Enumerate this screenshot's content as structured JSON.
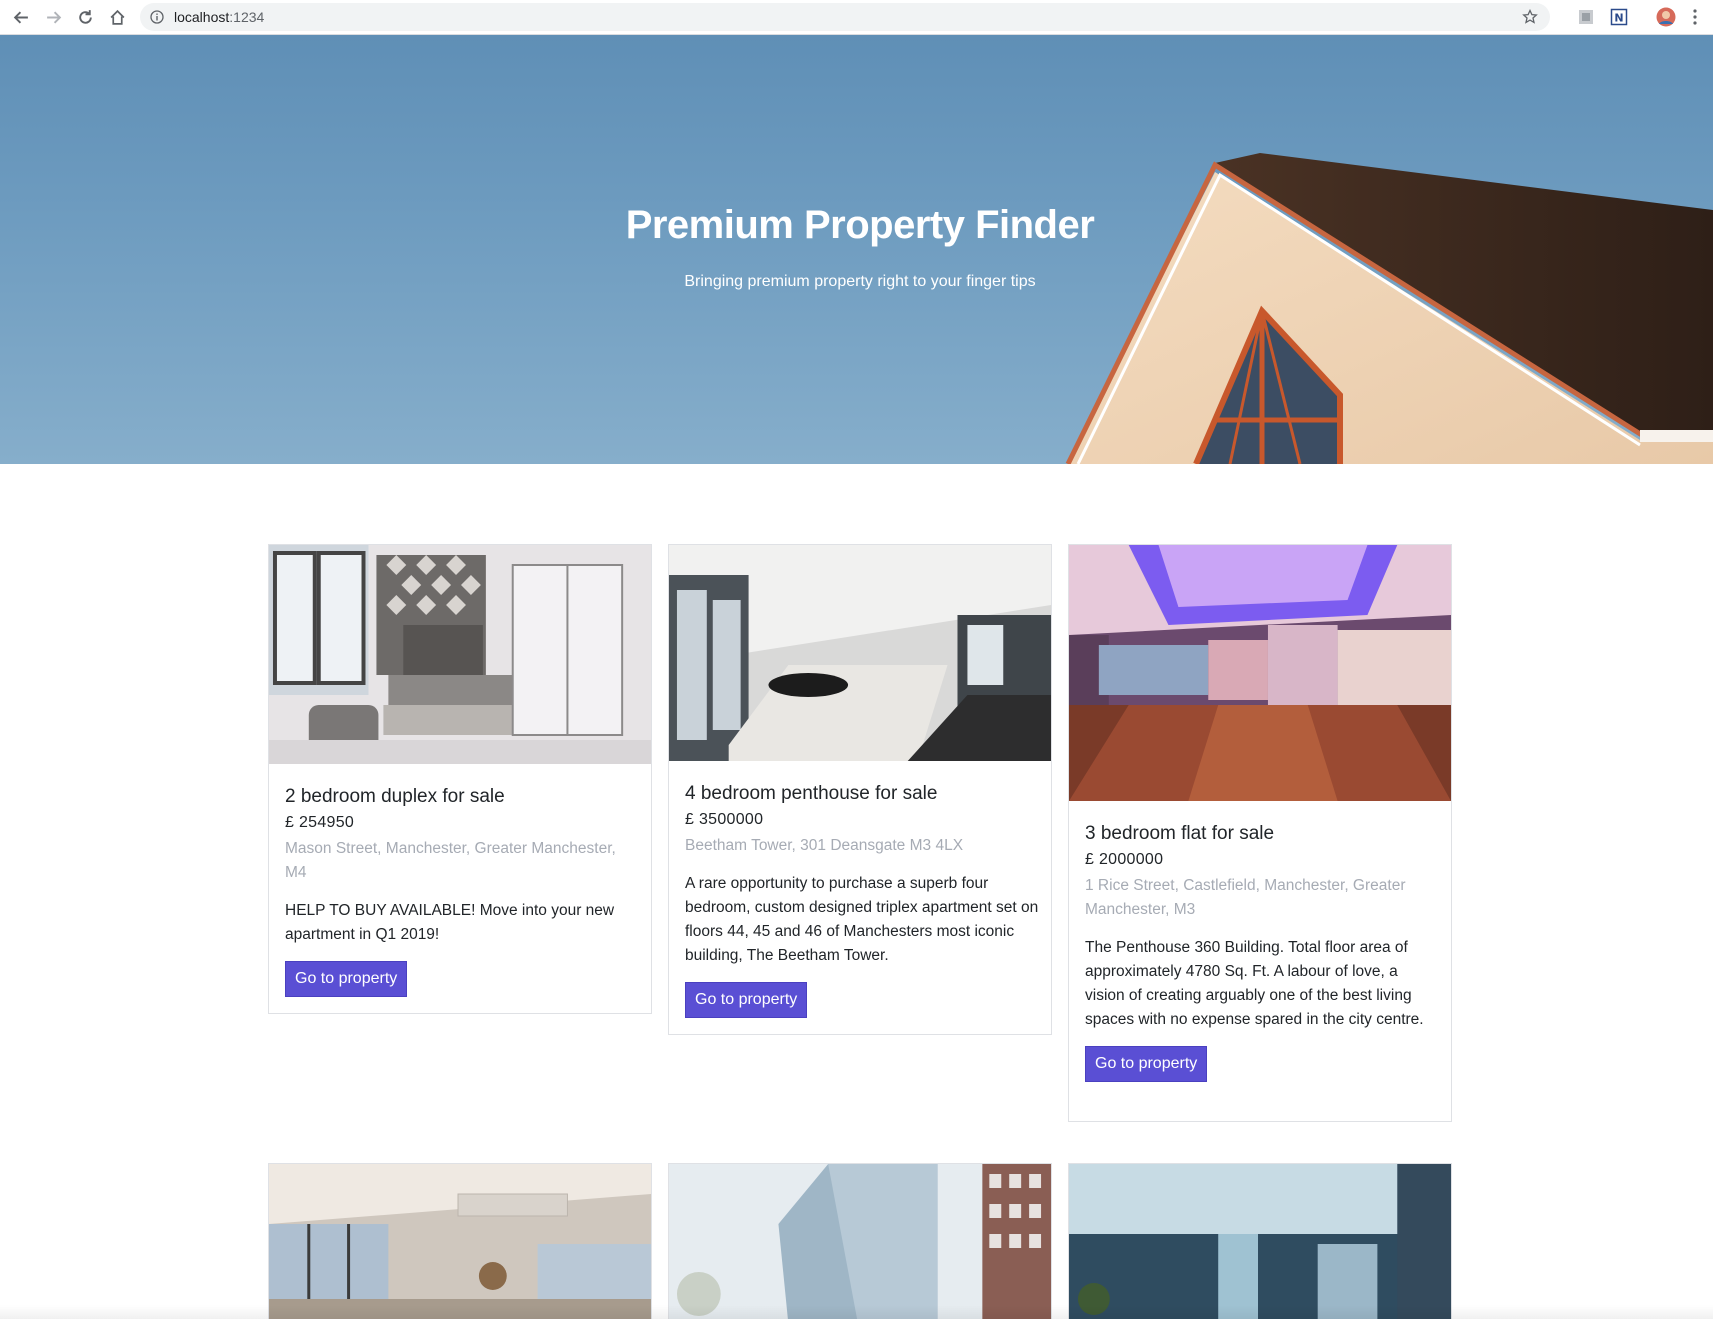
{
  "browser": {
    "url_host": "localhost",
    "url_port": ":1234"
  },
  "hero": {
    "title": "Premium Property Finder",
    "subtitle": "Bringing premium property right to your finger tips"
  },
  "properties": [
    {
      "title": "2 bedroom duplex for sale",
      "price": "£ 254950",
      "address": "Mason Street, Manchester, Greater Manchester, M4",
      "description": "HELP TO BUY AVAILABLE! Move into your new apartment in Q1 2019!",
      "button": "Go to property"
    },
    {
      "title": "4 bedroom penthouse for sale",
      "price": "£ 3500000",
      "address": "Beetham Tower, 301 Deansgate M3 4LX",
      "description": "A rare opportunity to purchase a superb four bedroom, custom designed triplex apartment set on floors 44, 45 and 46 of Manchesters most iconic building, The Beetham Tower.",
      "button": "Go to property"
    },
    {
      "title": "3 bedroom flat for sale",
      "price": "£ 2000000",
      "address": "1 Rice Street, Castlefield, Manchester, Greater Manchester, M3",
      "description": "The Penthouse 360 Building. Total floor area of approximately 4780 Sq. Ft. A labour of love, a vision of creating arguably one of the best living spaces with no expense spared in the city centre.",
      "button": "Go to property"
    }
  ],
  "colors": {
    "accent": "#5a4fd4",
    "muted": "#a6abb4",
    "sky": "#6d9bbf"
  }
}
